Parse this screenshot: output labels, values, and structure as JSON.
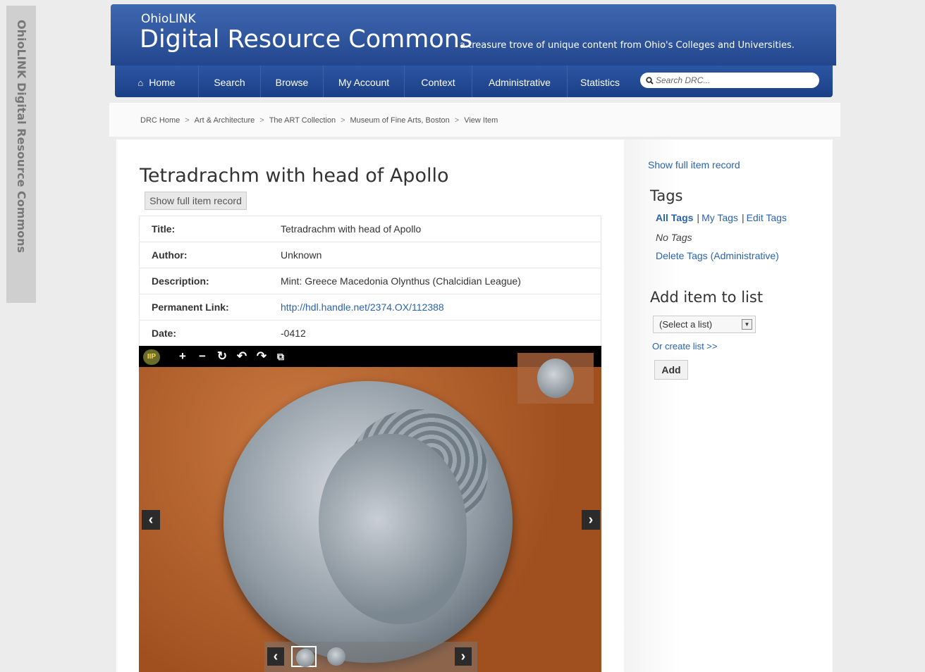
{
  "side_tab": {
    "label": "OhioLINK Digital Resource Commons"
  },
  "header": {
    "brand_small": "OhioLINK",
    "brand_big": "Digital Resource Commons",
    "tagline": "a treasure trove of unique content from Ohio's Colleges and Universities."
  },
  "nav": {
    "items": [
      "Home",
      "Search",
      "Browse",
      "My Account",
      "Context",
      "Administrative",
      "Statistics"
    ],
    "search_placeholder": "Search DRC..."
  },
  "breadcrumb": [
    "DRC Home",
    "Art & Architecture",
    "The ART Collection",
    "Museum of Fine Arts, Boston",
    "View Item"
  ],
  "item": {
    "title": "Tetradrachm with head of Apollo",
    "show_full_button": "Show full item record",
    "metadata": [
      {
        "label": "Title:",
        "value": "Tetradrachm with head of Apollo"
      },
      {
        "label": "Author:",
        "value": "Unknown"
      },
      {
        "label": "Description:",
        "value": "Mint: Greece Macedonia Olynthus (Chalcidian League)"
      },
      {
        "label": "Permanent Link:",
        "value": "http://hdl.handle.net/2374.OX/112388"
      },
      {
        "label": "Date:",
        "value": "-0412"
      }
    ]
  },
  "viewer": {
    "logo": "IIP",
    "toolbar_icons": [
      "zoom-in-icon",
      "zoom-out-icon",
      "reset-icon",
      "rotate-left-icon",
      "rotate-right-icon",
      "fullscreen-icon"
    ],
    "thumbnail_count": 2,
    "selected_thumbnail": 1
  },
  "sidebar": {
    "show_full_link": "Show full item record",
    "tags_heading": "Tags",
    "tag_links": [
      "All Tags",
      "My Tags",
      "Edit Tags"
    ],
    "no_tags": "No Tags",
    "delete_tags": "Delete Tags (Administrative)",
    "add_heading": "Add item to list",
    "list_select": "(Select a list)",
    "create_list": "Or create list >>",
    "add_button": "Add"
  },
  "colors": {
    "header_blue": "#2c56a3",
    "link_blue": "#2a63ad",
    "page_bg": "#ececec"
  }
}
